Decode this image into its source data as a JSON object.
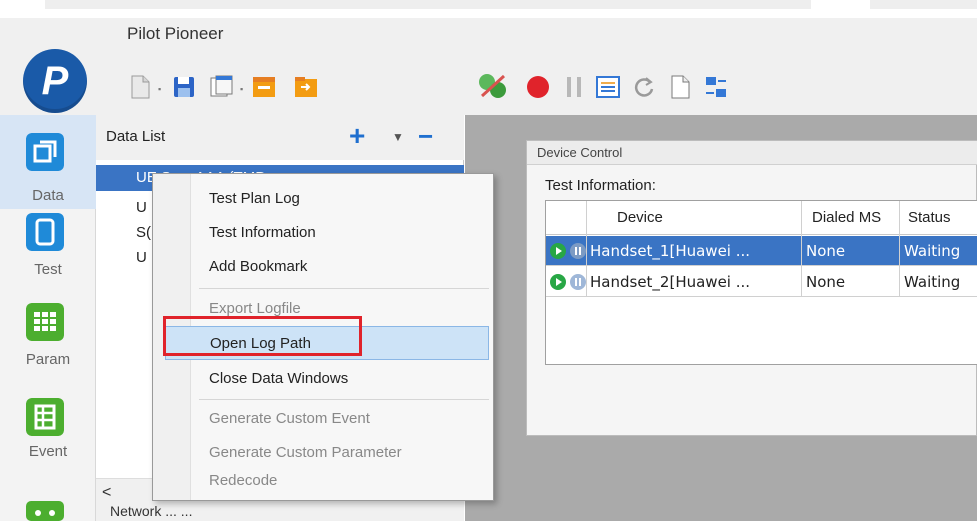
{
  "app": {
    "title": "Pilot Pioneer",
    "logo_letter": "P",
    "accent": "#1a5aa8"
  },
  "toolbar": {
    "icons": [
      "new-file-icon",
      "save-icon",
      "window-icon",
      "folder-export-icon",
      "folder-import-icon",
      "connect-devices-icon",
      "record-icon",
      "pause-icon",
      "report-icon",
      "refresh-icon",
      "document-icon",
      "swap-icon"
    ]
  },
  "nav": {
    "items": [
      {
        "label": "Data",
        "icon": "data-icon",
        "active": true
      },
      {
        "label": "Test",
        "icon": "test-icon"
      },
      {
        "label": "Param",
        "icon": "param-icon"
      },
      {
        "label": "Event",
        "icon": "event-icon"
      }
    ]
  },
  "datalist": {
    "title": "Data List",
    "rows": [
      "UE Se... AAA (TMP",
      "U",
      "S(",
      "U"
    ],
    "scroll_left": "<",
    "bottom_partial": "Network ... ..."
  },
  "device_control": {
    "title": "Device Control",
    "section_label": "Test Information:",
    "columns": [
      "Device",
      "Dialed MS",
      "Status"
    ],
    "rows": [
      {
        "device": "Handset_1[Huawei ...",
        "dialed_ms": "None",
        "status": "Waiting",
        "selected": true
      },
      {
        "device": "Handset_2[Huawei ...",
        "dialed_ms": "None",
        "status": "Waiting",
        "selected": false
      }
    ]
  },
  "context_menu": {
    "items": [
      {
        "label": "Test Plan Log",
        "disabled": false
      },
      {
        "label": "Test Information",
        "disabled": false
      },
      {
        "label": "Add Bookmark",
        "disabled": false
      },
      {
        "label": "Export Logfile",
        "disabled": true
      },
      {
        "label": "Open Log Path",
        "disabled": false,
        "highlighted": true
      },
      {
        "label": "Close Data Windows",
        "disabled": false
      },
      {
        "label": "Generate Custom Event",
        "disabled": true
      },
      {
        "label": "Generate Custom Parameter",
        "disabled": true
      },
      {
        "label": "Redecode",
        "disabled": true
      }
    ],
    "highlight_color": "#e0232b"
  }
}
